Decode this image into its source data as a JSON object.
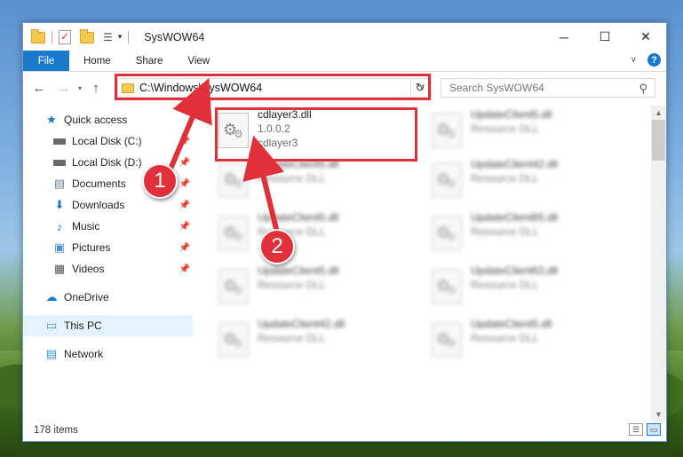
{
  "window": {
    "title": "SysWOW64",
    "controls": {
      "minimize": "─",
      "maximize": "☐",
      "close": "✕"
    }
  },
  "ribbon": {
    "tabs": [
      {
        "label": "File"
      },
      {
        "label": "Home"
      },
      {
        "label": "Share"
      },
      {
        "label": "View"
      }
    ],
    "help": "?"
  },
  "navigation": {
    "back": "←",
    "forward": "→",
    "recent": "▾",
    "up": "↑",
    "address": "C:\\Windows\\SysWOW64",
    "refresh": "↻",
    "search_placeholder": "Search SysWOW64"
  },
  "sidebar": {
    "items": [
      {
        "label": "Quick access",
        "icon": "star-icon"
      },
      {
        "label": "Local Disk (C:)",
        "icon": "drive-icon"
      },
      {
        "label": "Local Disk (D:)",
        "icon": "drive-icon"
      },
      {
        "label": "Documents",
        "icon": "documents-icon"
      },
      {
        "label": "Downloads",
        "icon": "download-icon"
      },
      {
        "label": "Music",
        "icon": "music-icon"
      },
      {
        "label": "Pictures",
        "icon": "pictures-icon"
      },
      {
        "label": "Videos",
        "icon": "videos-icon"
      },
      {
        "label": "OneDrive",
        "icon": "cloud-icon"
      },
      {
        "label": "This PC",
        "icon": "computer-icon"
      },
      {
        "label": "Network",
        "icon": "network-icon"
      }
    ]
  },
  "files": {
    "highlighted": {
      "name": "cdlayer3.dll",
      "version": "1.0.0.2",
      "description": "cdlayer3"
    },
    "left_column": [
      {
        "name": "UpdateClient5.dll",
        "type": "Resource DLL"
      },
      {
        "name": "UpdateClient5.dll",
        "type": "Resource DLL"
      },
      {
        "name": "UpdateClient5.dll",
        "type": "Resource DLL"
      },
      {
        "name": "UpdateClient42.dll",
        "type": "Resource DLL"
      }
    ],
    "right_column": [
      {
        "name": "UpdateClient5.dll",
        "type": "Resource DLL"
      },
      {
        "name": "UpdateClient42.dll",
        "type": "Resource DLL"
      },
      {
        "name": "UpdateClient65.dll",
        "type": "Resource DLL"
      },
      {
        "name": "UpdateClient63.dll",
        "type": "Resource DLL"
      },
      {
        "name": "UpdateClient5.dll",
        "type": "Resource DLL"
      }
    ]
  },
  "status": {
    "item_count": "178 items"
  },
  "callouts": {
    "one": "1",
    "two": "2"
  },
  "colors": {
    "accent": "#1979ca",
    "highlight": "#e0313b"
  }
}
